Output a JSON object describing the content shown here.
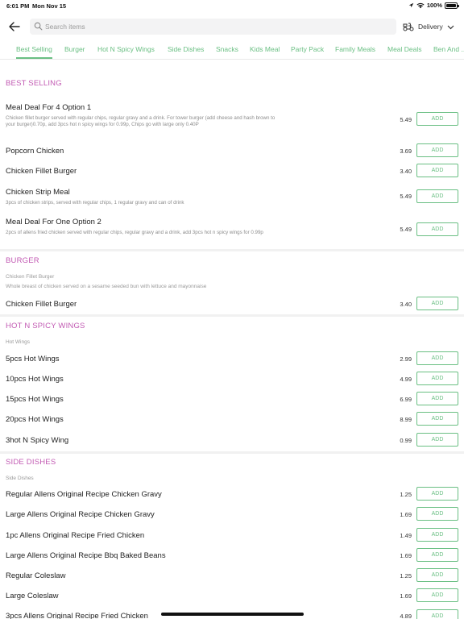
{
  "status_bar": {
    "time": "6:01 PM",
    "date": "Mon Nov 15",
    "battery": "100%"
  },
  "search": {
    "placeholder": "Search items"
  },
  "delivery": {
    "label": "Delivery"
  },
  "tabs": [
    "Best Selling",
    "Burger",
    "Hot N Spicy Wings",
    "Side Dishes",
    "Snacks",
    "Kids Meal",
    "Party Pack",
    "Family Meals",
    "Meal Deals",
    "Ben And ..."
  ],
  "active_tab": "Best Selling",
  "colors": {
    "accent_green": "#6abf83",
    "section_pink": "#c25ab3"
  },
  "sections": {
    "best_selling": {
      "title": "BEST SELLING",
      "items": [
        {
          "name": "Meal Deal For 4 Option 1",
          "desc": "Chicken fillet burger served with regular chips, regular gravy and a drink. For tower burger (add cheese and hash brown to your burger)0.70p, add 3pcs hot n spicy wings for 0.99p, Chips go with large only 0.40P",
          "price": "5.49",
          "add": "ADD"
        },
        {
          "name": "Popcorn Chicken",
          "price": "3.69",
          "add": "ADD"
        },
        {
          "name": "Chicken Fillet Burger",
          "price": "3.40",
          "add": "ADD"
        },
        {
          "name": "Chicken Strip Meal",
          "desc": "3pcs of chicken strips, served with regular chips, 1 regular gravy and can of drink",
          "price": "5.49",
          "add": "ADD"
        },
        {
          "name": "Meal Deal For One Option 2",
          "desc": "2pcs of allens fried chicken served with regular chips, regular gravy and a drink, add 3pcs hot n spicy wings for 0.99p",
          "price": "5.49",
          "add": "ADD"
        }
      ]
    },
    "burger": {
      "title": "BURGER",
      "subtitle": "Chicken Fillet Burger",
      "description": "Whole breast of chicken served on a sesame seeded bun with lettuce and mayonnaise",
      "items": [
        {
          "name": "Chicken Fillet Burger",
          "price": "3.40",
          "add": "ADD"
        }
      ]
    },
    "hot_wings": {
      "title": "HOT N SPICY WINGS",
      "subtitle": "Hot Wings",
      "items": [
        {
          "name": "5pcs Hot Wings",
          "price": "2.99",
          "add": "ADD"
        },
        {
          "name": "10pcs Hot Wings",
          "price": "4.99",
          "add": "ADD"
        },
        {
          "name": "15pcs Hot Wings",
          "price": "6.99",
          "add": "ADD"
        },
        {
          "name": "20pcs Hot Wings",
          "price": "8.99",
          "add": "ADD"
        },
        {
          "name": "3hot N Spicy Wing",
          "price": "0.99",
          "add": "ADD"
        }
      ]
    },
    "side_dishes": {
      "title": "SIDE DISHES",
      "subtitle": "Side Dishes",
      "items": [
        {
          "name": "Regular Allens Original Recipe Chicken Gravy",
          "price": "1.25",
          "add": "ADD"
        },
        {
          "name": "Large Allens Original Recipe Chicken Gravy",
          "price": "1.69",
          "add": "ADD"
        },
        {
          "name": "1pc Allens Original Recipe Fried Chicken",
          "price": "1.49",
          "add": "ADD"
        },
        {
          "name": "Large Allens Original Recipe Bbq Baked Beans",
          "price": "1.69",
          "add": "ADD"
        },
        {
          "name": "Regular Coleslaw",
          "price": "1.25",
          "add": "ADD"
        },
        {
          "name": "Large Coleslaw",
          "price": "1.69",
          "add": "ADD"
        },
        {
          "name": "3pcs Allens Original Recipe Fried Chicken",
          "price": "4.89",
          "add": "ADD"
        }
      ]
    }
  }
}
